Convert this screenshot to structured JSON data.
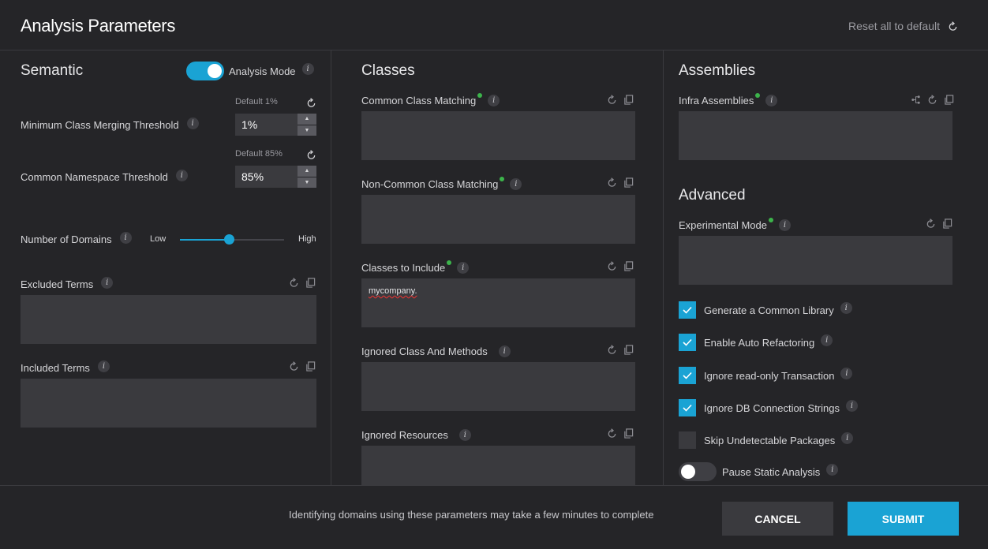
{
  "header": {
    "title": "Analysis Parameters",
    "reset_all": "Reset all to default"
  },
  "semantic": {
    "title": "Semantic",
    "analysis_mode": {
      "label": "Analysis Mode",
      "on": true
    },
    "min_class_merging": {
      "label": "Minimum Class Merging Threshold",
      "default": "Default 1%",
      "value": "1%"
    },
    "common_namespace": {
      "label": "Common Namespace Threshold",
      "default": "Default 85%",
      "value": "85%"
    },
    "domains": {
      "label": "Number of Domains",
      "low": "Low",
      "high": "High",
      "level": 0.47
    },
    "excluded_terms": {
      "label": "Excluded Terms",
      "value": ""
    },
    "included_terms": {
      "label": "Included Terms",
      "value": ""
    }
  },
  "classes": {
    "title": "Classes",
    "common_class_matching": {
      "label": "Common Class Matching",
      "value": ""
    },
    "non_common_class_matching": {
      "label": "Non-Common Class Matching",
      "value": ""
    },
    "classes_to_include": {
      "label": "Classes to Include",
      "value": "mycompany."
    },
    "ignored_class_methods": {
      "label": "Ignored Class And Methods",
      "value": ""
    },
    "ignored_resources": {
      "label": "Ignored Resources",
      "value": ""
    }
  },
  "assemblies": {
    "title": "Assemblies",
    "infra_assemblies": {
      "label": "Infra Assemblies",
      "value": ""
    }
  },
  "advanced": {
    "title": "Advanced",
    "experimental_mode": {
      "label": "Experimental Mode",
      "value": ""
    },
    "options": [
      {
        "label": "Generate a Common Library",
        "checked": true
      },
      {
        "label": "Enable Auto Refactoring",
        "checked": true
      },
      {
        "label": "Ignore read-only Transaction",
        "checked": true
      },
      {
        "label": "Ignore DB Connection Strings",
        "checked": true
      },
      {
        "label": "Skip Undetectable Packages",
        "checked": false
      }
    ],
    "pause_static": {
      "label": "Pause Static Analysis",
      "on": false
    }
  },
  "footer": {
    "note": "Identifying domains using these parameters may take a few minutes to complete",
    "cancel": "CANCEL",
    "submit": "SUBMIT"
  },
  "colors": {
    "accent": "#1aa3d4",
    "indicator": "#3cb44b",
    "field": "#3a3a3e",
    "background": "#252528"
  },
  "icons": [
    "reset-icon",
    "copy-icon",
    "info-icon",
    "tree-icon",
    "check-icon",
    "spin-up-icon",
    "spin-down-icon"
  ]
}
